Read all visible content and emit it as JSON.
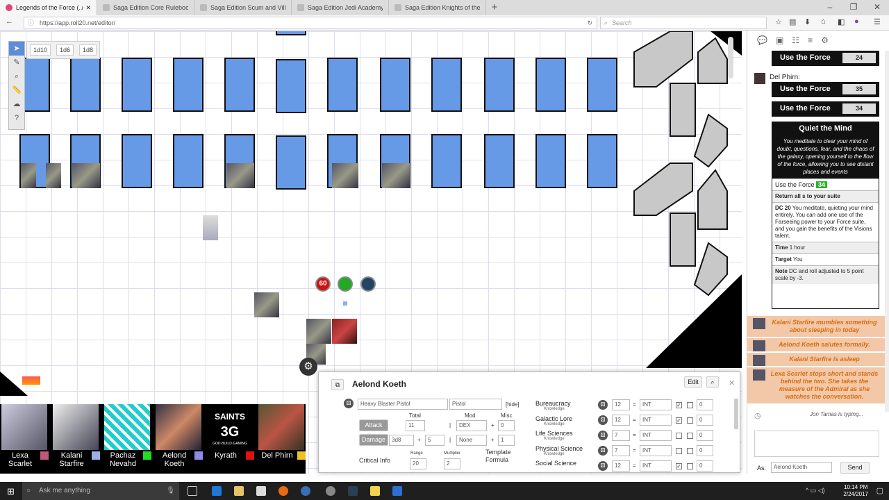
{
  "browser": {
    "tabs": [
      {
        "label": "Legends of the Force (..."
      },
      {
        "label": "Saga Edition Core Rulebook - ..."
      },
      {
        "label": "Saga Edition Scum and Villain..."
      },
      {
        "label": "Saga Edition Jedi Academy Tra..."
      },
      {
        "label": "Saga Edition Knights of the Ol..."
      }
    ],
    "url": "https://app.roll20.net/editor/",
    "search_placeholder": "Search"
  },
  "editor": {
    "dice_buttons": [
      "1d10",
      "1d6",
      "1d8"
    ],
    "token_bar_values": [
      "60",
      "",
      ""
    ],
    "players": [
      {
        "name": "Lexa\nScarlet",
        "color": "#c0567a"
      },
      {
        "name": "Kalani\nStarfire",
        "color": "#9db0e6"
      },
      {
        "name": "Pachaz\nNevahd",
        "color": "#22dd22"
      },
      {
        "name": "Aelond\nKoeth",
        "color": "#8c8ce6"
      },
      {
        "name": "Kyrath",
        "color": "#dd1111"
      },
      {
        "name": "Del Phirn",
        "color": "#f0c020"
      }
    ]
  },
  "sheet": {
    "character_name": "Aelond Koeth",
    "edit_label": "Edit",
    "weapon": {
      "name": "Heavy Blaster Pistol",
      "type": "Pistol",
      "hide_label": "[hide]",
      "col_total": "Total",
      "col_mod": "Mod",
      "col_misc": "Misc",
      "attack_label": "Attack",
      "attack_total": "11",
      "attack_mod": "DEX",
      "attack_misc": "0",
      "damage_label": "Damage",
      "damage_dice": "3d8",
      "damage_plus": "5",
      "damage_mod": "None",
      "damage_misc": "1",
      "critical_label": "Critical Info",
      "range_label": "Range",
      "range_value": "20",
      "multiplier_label": "Multiplier",
      "multiplier_value": "2",
      "template_label": "Template\nFormula"
    },
    "skills": [
      {
        "name": "Bureaucracy",
        "sub": "Knowledge",
        "total": "12",
        "attr": "INT",
        "trained": true,
        "misc": "0"
      },
      {
        "name": "Galactic Lore",
        "sub": "Knowledge",
        "total": "12",
        "attr": "INT",
        "trained": true,
        "misc": "0"
      },
      {
        "name": "Life Sciences",
        "sub": "Knowledge",
        "total": "7",
        "attr": "INT",
        "trained": false,
        "misc": "0"
      },
      {
        "name": "Physical Science",
        "sub": "Knowledge",
        "total": "7",
        "attr": "INT",
        "trained": false,
        "misc": "0"
      },
      {
        "name": "Social Science",
        "sub": "",
        "total": "12",
        "attr": "INT",
        "trained": true,
        "misc": "0"
      }
    ]
  },
  "chat": {
    "rolls": [
      {
        "label": "Use the Force",
        "value": "24"
      },
      {
        "label": "Use the Force",
        "value": "35"
      },
      {
        "label": "Use the Force",
        "value": "34"
      }
    ],
    "speaker": "Del Phirn:",
    "power": {
      "title": "Quiet the Mind",
      "description": "You meditate to clear your mind of doubt, questions, fear, and the chaos of the galaxy, opening yourself to the flow of the force, allowing you to see distant places and events",
      "use_label": "Use the Force",
      "use_value": "34",
      "return_label": "Return all s to your suite",
      "dc_label": "DC 20",
      "dc_text": "You meditate, quieting your mind entirely. You can add one use of the Farseeing power to your Force suite, and you gain the benefits of the Visions talent.",
      "time_label": "Time",
      "time_value": "1 hour",
      "target_label": "Target",
      "target_value": "You",
      "note_label": "Note",
      "note_value": "DC and roll adjusted to 5 point scale by -3."
    },
    "emotes": [
      "Kalani Starfire mumbles something about sleeping in today",
      "Aelond Koeth salutes formally.",
      "Kalani Starfire is asleep",
      "Lexa Scarlet stops short and stands behind the two. She takes the measure of the Admiral as she watches the conversation."
    ],
    "typing": "Jon Tamas is typing...",
    "as_label": "As:",
    "as_value": "Aelond Koeth",
    "send_label": "Send"
  },
  "taskbar": {
    "search_placeholder": "Ask me anything",
    "time": "10:14 PM",
    "date": "2/24/2017"
  },
  "colors": {
    "wall_blue": "#6699e6",
    "emote_bg": "#f3c8a8",
    "emote_text": "#d96d10",
    "roll_green": "#2bb52b"
  }
}
